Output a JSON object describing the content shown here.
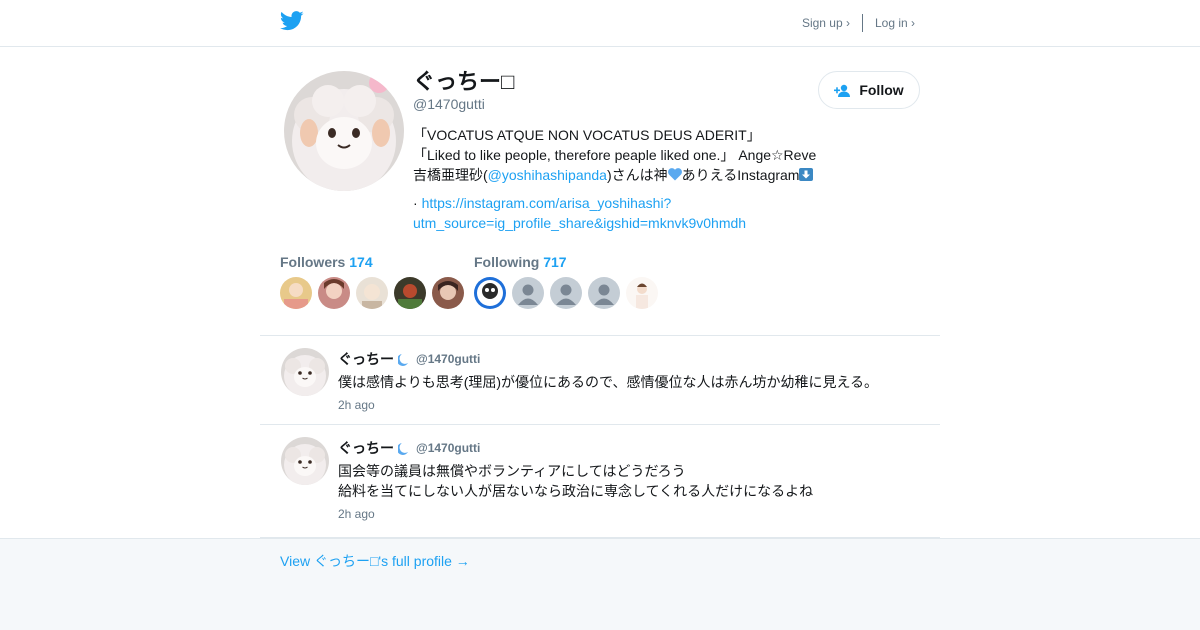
{
  "header": {
    "logo_icon": "twitter-bird-icon",
    "signup_label": "Sign up ›",
    "login_label": "Log in ›"
  },
  "profile": {
    "display_name": "ぐっちー□",
    "handle": "@1470gutti",
    "follow_label": "Follow",
    "bio_line1": "「VOCATUS ATQUE NON VOCATUS DEUS ADERIT」",
    "bio_line2": "「Liked to like people, therefore peaple liked one.」 Ange☆Reve",
    "bio_line3_prefix": "吉橋亜理砂(",
    "bio_mention": "@yoshihashipanda",
    "bio_line3_middle": ")さんは神",
    "bio_line3_middle2": "ありえるInstagram",
    "bio_link_bullet": "·",
    "bio_link_1": "https://instagram.com/arisa_yoshihashi?",
    "bio_link_2": "utm_source=ig_profile_share&igshid=mknvk9v0hmdh"
  },
  "followers": {
    "label": "Followers",
    "count": "174"
  },
  "following": {
    "label": "Following",
    "count": "717"
  },
  "tweets": [
    {
      "name": "ぐっちー",
      "handle": "@1470gutti",
      "text": "僕は感情よりも思考(理屈)が優位にあるので、感情優位な人は赤ん坊か幼稚に見える。",
      "time": "2h ago"
    },
    {
      "name": "ぐっちー",
      "handle": "@1470gutti",
      "text": "国会等の議員は無償やボランティアにしてはどうだろう\n給料を当てにしない人が居ないなら政治に専念してくれる人だけになるよね",
      "time": "2h ago"
    }
  ],
  "footer": {
    "link_label": "View ぐっちー□'s full profile →"
  },
  "colors": {
    "accent": "#1da1f2",
    "muted": "#657786",
    "border": "#e1e8ed",
    "footer_bg": "#f5f8fa"
  }
}
